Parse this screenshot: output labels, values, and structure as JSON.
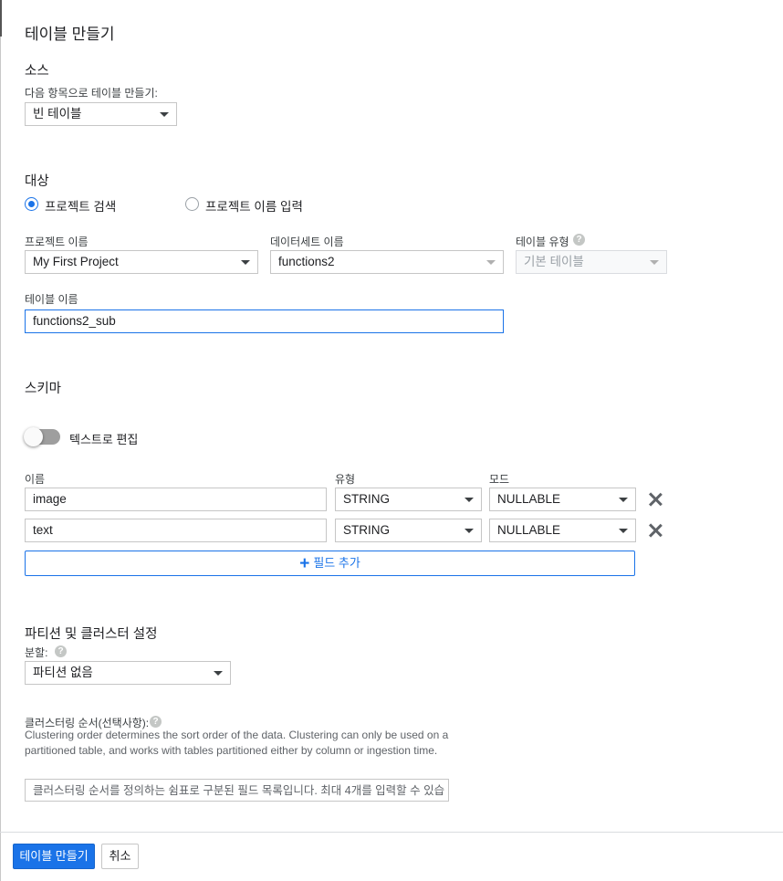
{
  "page_title": "테이블 만들기",
  "source": {
    "heading": "소스",
    "create_from_label": "다음 항목으로 테이블 만들기:",
    "create_from_value": "빈 테이블"
  },
  "destination": {
    "heading": "대상",
    "radio_search": "프로젝트 검색",
    "radio_enter": "프로젝트 이름 입력",
    "selected_radio": "프로젝트 검색",
    "project_label": "프로젝트 이름",
    "project_value": "My First Project",
    "dataset_label": "데이터세트 이름",
    "dataset_value": "functions2",
    "table_type_label": "테이블 유형",
    "table_type_value": "기본 테이블",
    "table_name_label": "테이블 이름",
    "table_name_value": "functions2_sub"
  },
  "schema": {
    "heading": "스키마",
    "edit_as_text_label": "텍스트로 편집",
    "edit_as_text_on": false,
    "col_name": "이름",
    "col_type": "유형",
    "col_mode": "모드",
    "fields": [
      {
        "name": "image",
        "type": "STRING",
        "mode": "NULLABLE"
      },
      {
        "name": "text",
        "type": "STRING",
        "mode": "NULLABLE"
      }
    ],
    "add_field_label": "필드 추가",
    "add_field_icon": "+"
  },
  "partition": {
    "heading": "파티션 및 클러스터 설정",
    "partition_label": "분할:",
    "partition_value": "파티션 없음",
    "clustering_label": "클러스터링 순서(선택사항):",
    "clustering_desc": "Clustering order determines the sort order of the data. Clustering can only be used on a partitioned table, and works with tables partitioned either by column or ingestion time.",
    "clustering_placeholder": "클러스터링 순서를 정의하는 쉼표로 구분된 필드 목록입니다. 최대 4개를 입력할 수 있습",
    "help_icon": "?"
  },
  "footer": {
    "create_button": "테이블 만들기",
    "cancel_button": "취소"
  },
  "colors": {
    "accent": "#1a73e8",
    "text": "#202124",
    "border": "#c6c6c6"
  }
}
